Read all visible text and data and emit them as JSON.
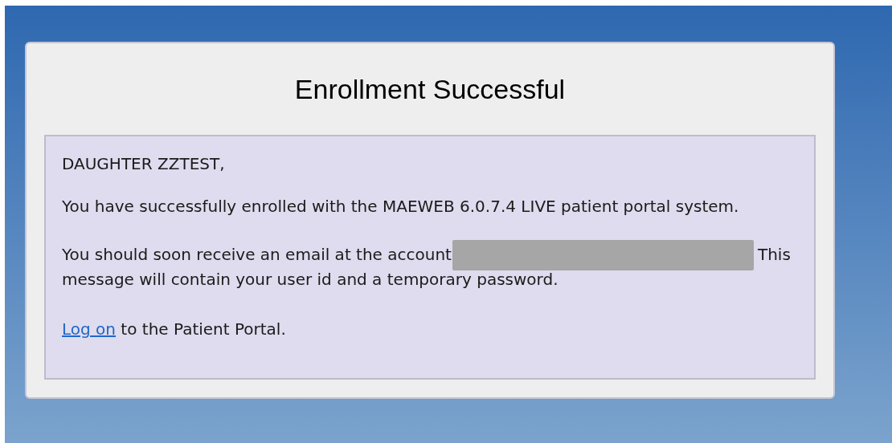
{
  "title": "Enrollment Successful",
  "greeting": "DAUGHTER ZZTEST,",
  "paragraphs": [
    {
      "kind": "text",
      "text": "You have successfully enrolled with the MAEWEB 6.0.7.4 LIVE patient portal system."
    },
    {
      "kind": "redacted",
      "before": "You should soon receive an email at the account",
      "redacted": true,
      "after": "This",
      "continuation": "message will contain your user id and a temporary password."
    },
    {
      "kind": "link",
      "link": "Log on",
      "after": "to the Patient Portal."
    }
  ]
}
